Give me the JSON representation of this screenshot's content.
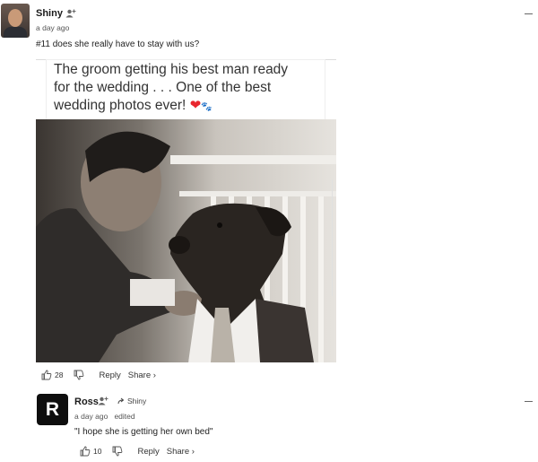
{
  "comment": {
    "username": "Shiny",
    "time": "a day ago",
    "text": "#11 does she really have to stay with us?",
    "image": {
      "caption_line1": "The groom getting his best man ready",
      "caption_line2": "for the wedding . . . One of the best",
      "caption_line3": "wedding photos ever!",
      "heart_glyph": "❤",
      "paw_glyph": "🐾"
    },
    "likes": "28",
    "reply_label": "Reply",
    "share_label": "Share ›"
  },
  "reply": {
    "avatar_letter": "R",
    "username": "Ross",
    "reply_to": "Shiny",
    "time": "a day ago",
    "edited": "edited",
    "text": "\"I hope she is getting her own bed\"",
    "likes": "10",
    "reply_label": "Reply",
    "share_label": "Share ›"
  },
  "colors": {
    "accent_heart": "#e8262e",
    "text_primary": "#1a1a1a",
    "text_meta": "#555555"
  }
}
